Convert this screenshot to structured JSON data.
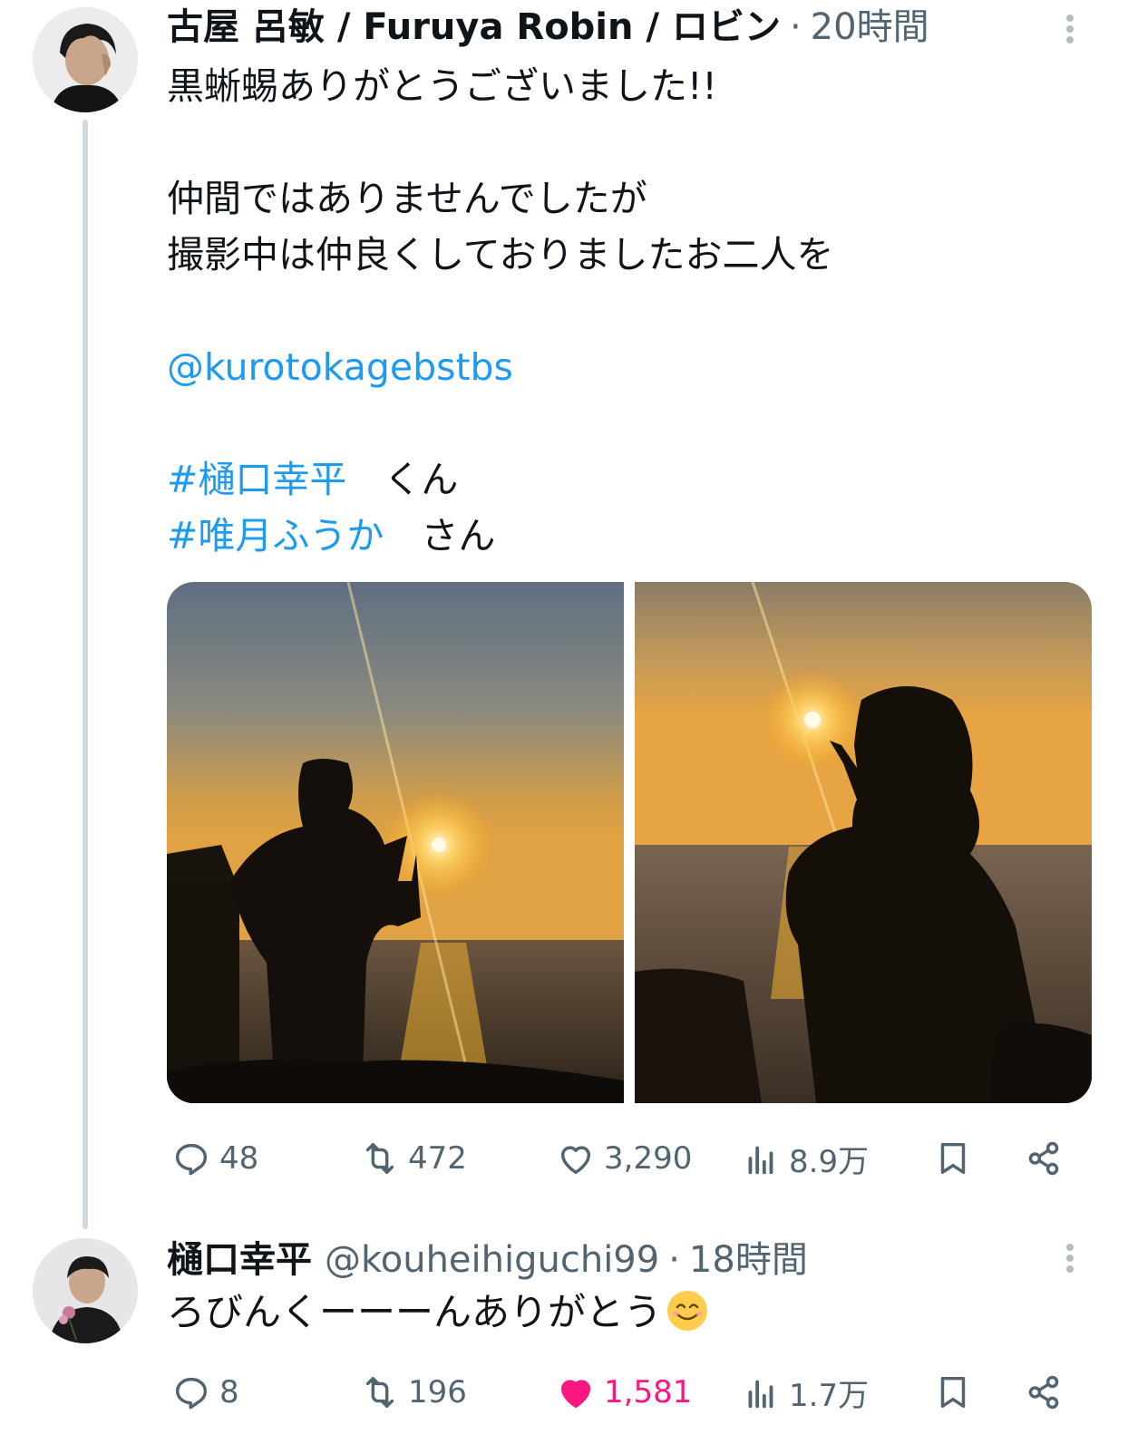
{
  "tweet1": {
    "display_name": "古屋 呂敏 / Furuya Robin / ロビン",
    "time": "20時間",
    "text": {
      "line1": "黒蜥蜴ありがとうございました!!",
      "line2": "仲間ではありませんでしたが",
      "line3": "撮影中は仲良くしておりましたお二人を",
      "mention": "@kurotokagebstbs",
      "hashtag1": "#樋口幸平",
      "suffix1": "　くん",
      "hashtag2": "#唯月ふうか",
      "suffix2": "　さん"
    },
    "actions": {
      "reply_icon": "reply-icon",
      "replies": "48",
      "retweet_icon": "retweet-icon",
      "retweets": "472",
      "like_icon": "heart-outline-icon",
      "likes": "3,290",
      "views_icon": "views-bar-icon",
      "views": "8.9万",
      "bookmark_icon": "bookmark-icon",
      "share_icon": "share-icon"
    }
  },
  "tweet2": {
    "display_name": "樋口幸平",
    "handle": "@kouheihiguchi99",
    "time": "18時間",
    "text": "ろびんくーーーんありがとう",
    "emoji": "smiling-face-emoji",
    "actions": {
      "replies": "8",
      "retweets": "196",
      "likes": "1,581",
      "like_icon": "heart-filled-icon",
      "views": "1.7万"
    }
  },
  "colors": {
    "link": "#1d9bf0",
    "muted": "#536471",
    "liked": "#f91880",
    "thread_line": "#cfd9de"
  }
}
